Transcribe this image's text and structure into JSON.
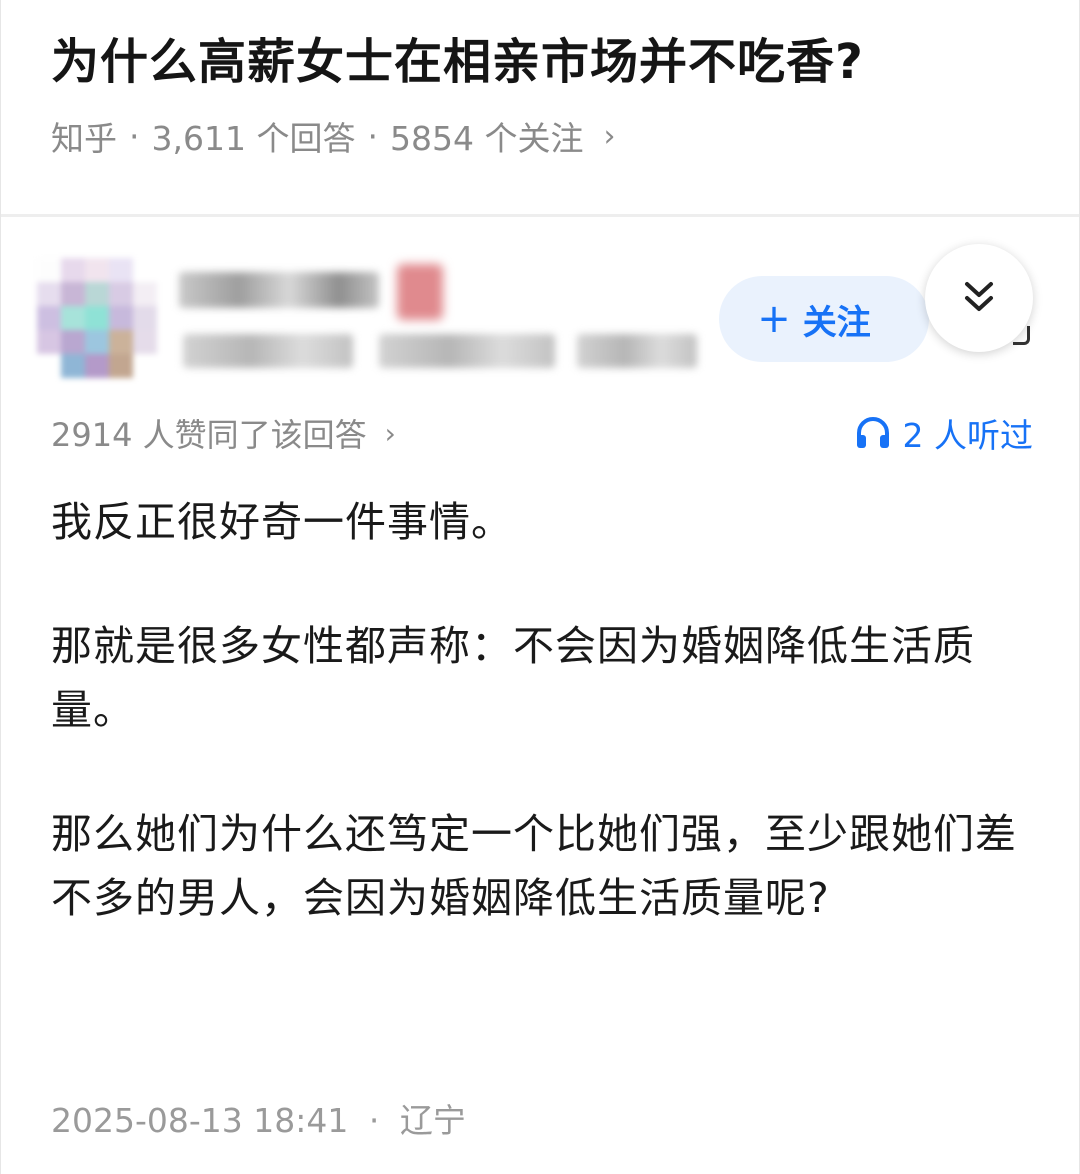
{
  "question": {
    "title": "为什么高薪女士在相亲市场并不吃香?",
    "source": "知乎",
    "separator": "·",
    "answer_count": "3,611 个回答",
    "follower_count": "5854 个关注",
    "chevron": "›"
  },
  "author": {
    "follow_plus": "+",
    "follow_label": "关注"
  },
  "stats": {
    "votes_text": "2914 人赞同了该回答",
    "votes_chevron": "›",
    "listen_text": "2 人听过"
  },
  "answer": {
    "paragraphs": [
      "我反正很好奇一件事情。",
      "那就是很多女性都声称：不会因为婚姻降低生活质量。",
      "那么她们为什么还笃定一个比她们强，至少跟她们差不多的男人，会因为婚姻降低生活质量呢?"
    ]
  },
  "footer": {
    "date": "2025-08-13 18:41",
    "separator": "·",
    "location": "辽宁"
  },
  "icons": {
    "collapse": "double-chevron-down-icon",
    "listen": "headphones-icon"
  },
  "colors": {
    "accent": "#1772f6",
    "follow_bg": "#eaf2fd",
    "meta_gray": "#8a8a8a"
  }
}
